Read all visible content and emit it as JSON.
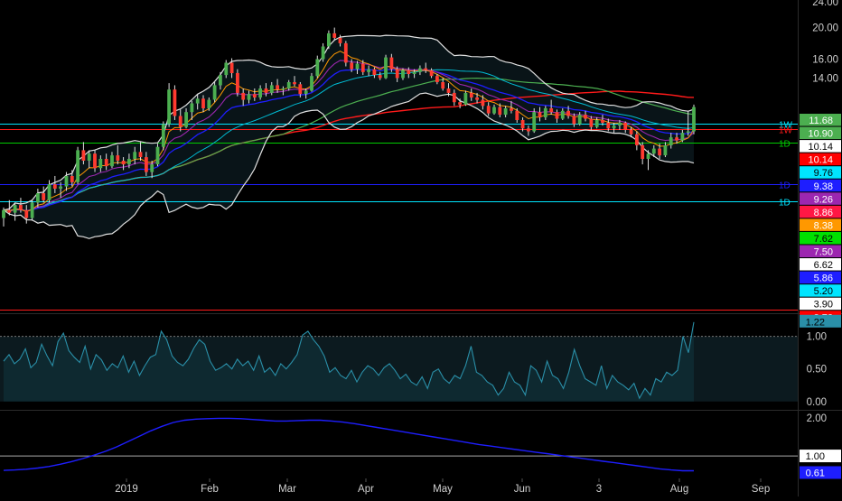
{
  "chart_data": [
    {
      "type": "candlestick",
      "ylim": [
        2.72,
        24.0
      ],
      "scale": "log",
      "price_axis_ticks": [
        "24.00",
        "20.00",
        "16.00",
        "14.00"
      ],
      "time_axis_labels": [
        "2019",
        "Feb",
        "Mar",
        "Apr",
        "May",
        "Jun",
        "3",
        "Aug",
        "Sep"
      ],
      "price_badges": [
        {
          "label": "11.68",
          "bg": "#4caf50",
          "fg": "#ffffff"
        },
        {
          "label": "10.90",
          "bg": "#4caf50",
          "fg": "#ffffff"
        },
        {
          "label": "10.14",
          "bg": "#ffffff",
          "fg": "#000000"
        },
        {
          "label": "10.14",
          "bg": "#ff0000",
          "fg": "#ffffff"
        },
        {
          "label": "9.76",
          "bg": "#00e5ff",
          "fg": "#000000"
        },
        {
          "label": "9.38",
          "bg": "#1e1eff",
          "fg": "#ffffff"
        },
        {
          "label": "9.26",
          "bg": "#9c27b0",
          "fg": "#ffffff"
        },
        {
          "label": "8.86",
          "bg": "#ff1744",
          "fg": "#ffffff"
        },
        {
          "label": "8.38",
          "bg": "#ff9800",
          "fg": "#ffffff"
        },
        {
          "label": "7.62",
          "bg": "#00e000",
          "fg": "#000000"
        },
        {
          "label": "7.50",
          "bg": "#9c27b0",
          "fg": "#ffffff"
        },
        {
          "label": "6.62",
          "bg": "#ffffff",
          "fg": "#000000"
        },
        {
          "label": "5.86",
          "bg": "#1e1eff",
          "fg": "#ffffff"
        },
        {
          "label": "5.20",
          "bg": "#00e5ff",
          "fg": "#000000"
        },
        {
          "label": "3.90",
          "bg": "#ffffff",
          "fg": "#000000"
        },
        {
          "label": "2.72",
          "bg": "#ff0000",
          "fg": "#ffffff"
        }
      ],
      "horizontal_levels": [
        {
          "value": 10.14,
          "label": "1W",
          "color": "#00e5ff"
        },
        {
          "value": 9.76,
          "label": "1W",
          "color": "#ff1a1a"
        },
        {
          "value": 8.86,
          "label": "1D",
          "color": "#00cc00"
        },
        {
          "value": 6.62,
          "label": "1D",
          "color": "#1e1eff"
        },
        {
          "value": 5.86,
          "label": "1D",
          "color": "#00e5ff"
        },
        {
          "value": 2.72,
          "label": "",
          "color": "#ff1a1a"
        }
      ],
      "ohlc": [
        [
          5.2,
          5.6,
          4.9,
          5.5
        ],
        [
          5.5,
          5.9,
          5.3,
          5.4
        ],
        [
          5.4,
          5.8,
          5.1,
          5.7
        ],
        [
          5.7,
          6.0,
          5.4,
          5.5
        ],
        [
          5.5,
          5.7,
          5.0,
          5.2
        ],
        [
          5.2,
          5.9,
          5.1,
          5.8
        ],
        [
          5.8,
          6.4,
          5.6,
          6.2
        ],
        [
          6.2,
          6.5,
          5.8,
          5.9
        ],
        [
          5.9,
          6.8,
          5.8,
          6.6
        ],
        [
          6.6,
          7.0,
          6.2,
          6.4
        ],
        [
          6.4,
          6.7,
          6.0,
          6.5
        ],
        [
          6.5,
          7.2,
          6.3,
          7.0
        ],
        [
          7.0,
          7.3,
          6.5,
          6.7
        ],
        [
          6.7,
          8.6,
          6.6,
          8.4
        ],
        [
          8.4,
          8.9,
          7.6,
          7.8
        ],
        [
          7.8,
          8.4,
          7.4,
          8.2
        ],
        [
          8.2,
          8.4,
          7.2,
          7.4
        ],
        [
          7.4,
          8.1,
          7.2,
          7.9
        ],
        [
          7.9,
          8.2,
          7.3,
          7.5
        ],
        [
          7.5,
          8.3,
          7.4,
          8.1
        ],
        [
          8.1,
          8.7,
          7.6,
          7.8
        ],
        [
          7.8,
          8.0,
          7.3,
          7.6
        ],
        [
          7.6,
          8.2,
          7.4,
          7.9
        ],
        [
          7.9,
          8.6,
          7.6,
          8.3
        ],
        [
          8.3,
          8.9,
          7.8,
          8.0
        ],
        [
          8.0,
          8.3,
          7.0,
          7.2
        ],
        [
          7.2,
          7.8,
          6.9,
          7.6
        ],
        [
          7.6,
          8.8,
          7.5,
          8.6
        ],
        [
          8.6,
          10.3,
          8.4,
          10.1
        ],
        [
          10.1,
          13.5,
          9.9,
          12.9
        ],
        [
          12.9,
          13.3,
          10.4,
          10.7
        ],
        [
          10.7,
          11.2,
          9.6,
          9.9
        ],
        [
          9.9,
          11.3,
          9.8,
          11.0
        ],
        [
          11.0,
          11.9,
          10.4,
          11.7
        ],
        [
          11.7,
          12.5,
          11.2,
          12.1
        ],
        [
          12.1,
          12.4,
          11.0,
          11.3
        ],
        [
          11.3,
          12.2,
          11.1,
          12.0
        ],
        [
          12.0,
          13.6,
          11.8,
          13.3
        ],
        [
          13.3,
          14.6,
          12.9,
          14.3
        ],
        [
          14.3,
          15.9,
          14.0,
          15.6
        ],
        [
          15.6,
          16.1,
          14.0,
          14.5
        ],
        [
          14.5,
          14.9,
          12.3,
          12.6
        ],
        [
          12.6,
          13.0,
          11.5,
          12.0
        ],
        [
          12.0,
          12.8,
          11.7,
          12.5
        ],
        [
          12.5,
          13.0,
          11.9,
          12.2
        ],
        [
          12.2,
          13.3,
          12.0,
          13.0
        ],
        [
          13.0,
          13.5,
          12.3,
          12.6
        ],
        [
          12.6,
          13.6,
          12.4,
          13.3
        ],
        [
          13.3,
          13.9,
          12.6,
          12.9
        ],
        [
          12.9,
          13.2,
          12.4,
          13.0
        ],
        [
          13.0,
          13.8,
          12.8,
          13.6
        ],
        [
          13.6,
          14.2,
          13.2,
          13.4
        ],
        [
          13.4,
          13.6,
          12.2,
          12.5
        ],
        [
          12.5,
          13.0,
          12.1,
          12.8
        ],
        [
          12.8,
          14.5,
          12.7,
          14.2
        ],
        [
          14.2,
          16.4,
          14.0,
          16.0
        ],
        [
          16.0,
          17.9,
          15.7,
          17.5
        ],
        [
          17.5,
          19.6,
          17.2,
          19.2
        ],
        [
          19.2,
          20.0,
          18.3,
          18.6
        ],
        [
          18.6,
          19.0,
          17.5,
          17.9
        ],
        [
          17.9,
          18.2,
          15.2,
          15.6
        ],
        [
          15.6,
          16.0,
          14.6,
          14.9
        ],
        [
          14.9,
          15.8,
          14.4,
          15.5
        ],
        [
          15.5,
          15.9,
          14.3,
          14.6
        ],
        [
          14.6,
          15.3,
          14.2,
          14.9
        ],
        [
          14.9,
          15.1,
          14.0,
          14.3
        ],
        [
          14.3,
          14.6,
          13.8,
          14.0
        ],
        [
          14.0,
          16.5,
          13.9,
          16.2
        ],
        [
          16.2,
          16.6,
          14.6,
          14.9
        ],
        [
          14.9,
          15.2,
          13.6,
          14.0
        ],
        [
          14.0,
          15.0,
          13.8,
          14.8
        ],
        [
          14.8,
          15.1,
          14.0,
          14.4
        ],
        [
          14.4,
          14.9,
          14.0,
          14.6
        ],
        [
          14.6,
          15.3,
          14.3,
          15.0
        ],
        [
          15.0,
          15.6,
          14.5,
          14.8
        ],
        [
          14.8,
          15.0,
          14.0,
          14.2
        ],
        [
          14.2,
          14.4,
          13.4,
          13.6
        ],
        [
          13.6,
          14.0,
          12.8,
          13.0
        ],
        [
          13.0,
          13.5,
          12.3,
          12.6
        ],
        [
          12.6,
          12.9,
          11.5,
          11.8
        ],
        [
          11.8,
          12.1,
          11.3,
          11.6
        ],
        [
          11.6,
          12.8,
          11.5,
          12.6
        ],
        [
          12.6,
          13.0,
          11.9,
          12.2
        ],
        [
          12.2,
          12.6,
          11.7,
          12.0
        ],
        [
          12.0,
          12.4,
          11.2,
          11.5
        ],
        [
          11.5,
          11.8,
          10.7,
          10.9
        ],
        [
          10.9,
          11.6,
          10.8,
          11.4
        ],
        [
          11.4,
          11.7,
          10.6,
          10.8
        ],
        [
          10.8,
          11.5,
          10.6,
          11.3
        ],
        [
          11.3,
          11.9,
          10.9,
          11.1
        ],
        [
          11.1,
          11.3,
          10.2,
          10.4
        ],
        [
          10.4,
          10.6,
          9.6,
          9.8
        ],
        [
          9.8,
          10.0,
          9.3,
          9.6
        ],
        [
          9.6,
          11.3,
          9.5,
          11.0
        ],
        [
          11.0,
          11.4,
          10.3,
          10.6
        ],
        [
          10.6,
          11.5,
          10.4,
          11.3
        ],
        [
          11.3,
          12.0,
          10.8,
          11.0
        ],
        [
          11.0,
          11.2,
          10.2,
          10.5
        ],
        [
          10.5,
          11.3,
          10.4,
          11.1
        ],
        [
          11.1,
          11.5,
          10.5,
          10.7
        ],
        [
          10.7,
          10.9,
          9.9,
          10.1
        ],
        [
          10.1,
          11.0,
          10.0,
          10.8
        ],
        [
          10.8,
          11.1,
          10.3,
          10.5
        ],
        [
          10.5,
          10.7,
          9.7,
          9.9
        ],
        [
          9.9,
          10.6,
          9.8,
          10.4
        ],
        [
          10.4,
          10.8,
          10.0,
          10.2
        ],
        [
          10.2,
          10.5,
          9.6,
          9.8
        ],
        [
          9.8,
          10.2,
          9.5,
          10.0
        ],
        [
          10.0,
          10.4,
          9.7,
          10.2
        ],
        [
          10.2,
          10.3,
          9.5,
          9.7
        ],
        [
          9.7,
          9.9,
          9.2,
          9.4
        ],
        [
          9.4,
          9.6,
          8.4,
          8.7
        ],
        [
          8.7,
          8.9,
          7.6,
          7.9
        ],
        [
          7.9,
          8.4,
          7.3,
          8.2
        ],
        [
          8.2,
          8.7,
          8.0,
          8.5
        ],
        [
          8.5,
          8.8,
          7.9,
          8.1
        ],
        [
          8.1,
          8.9,
          8.0,
          8.7
        ],
        [
          8.7,
          9.5,
          8.5,
          9.2
        ],
        [
          9.2,
          9.5,
          8.8,
          9.0
        ],
        [
          9.0,
          9.7,
          8.9,
          9.5
        ],
        [
          9.5,
          11.1,
          9.3,
          9.6
        ],
        [
          9.6,
          11.6,
          9.4,
          11.4
        ]
      ]
    },
    {
      "type": "line",
      "ylim": [
        -0.1,
        1.3
      ],
      "ticks": [
        "1.00",
        "0.50",
        "0.00"
      ],
      "reference_level": 1.0,
      "last_value_badge": "1.22",
      "series": [
        {
          "color": "#2a8fa8",
          "values": [
            0.62,
            0.72,
            0.58,
            0.65,
            0.81,
            0.52,
            0.6,
            0.88,
            0.7,
            0.55,
            0.92,
            1.05,
            0.78,
            0.68,
            0.6,
            0.85,
            0.5,
            0.72,
            0.64,
            0.48,
            0.58,
            0.52,
            0.7,
            0.45,
            0.62,
            0.4,
            0.55,
            0.68,
            0.72,
            1.08,
            0.95,
            0.7,
            0.6,
            0.55,
            0.65,
            0.82,
            0.95,
            0.88,
            0.62,
            0.48,
            0.52,
            0.58,
            0.5,
            0.65,
            0.55,
            0.62,
            0.48,
            0.7,
            0.45,
            0.52,
            0.4,
            0.58,
            0.5,
            0.6,
            0.72,
            1.02,
            1.08,
            0.95,
            0.85,
            0.7,
            0.45,
            0.52,
            0.4,
            0.35,
            0.48,
            0.3,
            0.45,
            0.55,
            0.5,
            0.4,
            0.52,
            0.58,
            0.48,
            0.35,
            0.42,
            0.3,
            0.25,
            0.38,
            0.2,
            0.45,
            0.5,
            0.35,
            0.28,
            0.4,
            0.35,
            0.55,
            0.85,
            0.45,
            0.4,
            0.3,
            0.25,
            0.1,
            0.2,
            0.45,
            0.3,
            0.25,
            0.1,
            0.55,
            0.48,
            0.3,
            0.62,
            0.4,
            0.35,
            0.2,
            0.45,
            0.8,
            0.55,
            0.35,
            0.3,
            0.25,
            0.55,
            0.2,
            0.4,
            0.3,
            0.25,
            0.18,
            0.28,
            0.05,
            0.2,
            0.1,
            0.35,
            0.3,
            0.45,
            0.4,
            0.48,
            1.0,
            0.75,
            1.22
          ]
        }
      ]
    },
    {
      "type": "line",
      "ylim": [
        0.55,
        2.0
      ],
      "ticks": [
        "2.00"
      ],
      "reference_level": 1.0,
      "reference_badge": "1.00",
      "last_value_badge": "0.61",
      "series": [
        {
          "color": "#1e1eff",
          "values": [
            0.62,
            0.63,
            0.65,
            0.68,
            0.72,
            0.78,
            0.85,
            0.93,
            1.02,
            1.12,
            1.24,
            1.38,
            1.52,
            1.66,
            1.78,
            1.88,
            1.94,
            1.97,
            1.98,
            1.99,
            1.99,
            1.98,
            1.96,
            1.94,
            1.92,
            1.92,
            1.93,
            1.94,
            1.94,
            1.92,
            1.89,
            1.85,
            1.8,
            1.75,
            1.7,
            1.65,
            1.6,
            1.55,
            1.5,
            1.45,
            1.4,
            1.35,
            1.3,
            1.26,
            1.22,
            1.18,
            1.14,
            1.1,
            1.06,
            1.02,
            0.98,
            0.94,
            0.9,
            0.86,
            0.82,
            0.78,
            0.74,
            0.7,
            0.66,
            0.63,
            0.61,
            0.61
          ]
        }
      ]
    }
  ]
}
